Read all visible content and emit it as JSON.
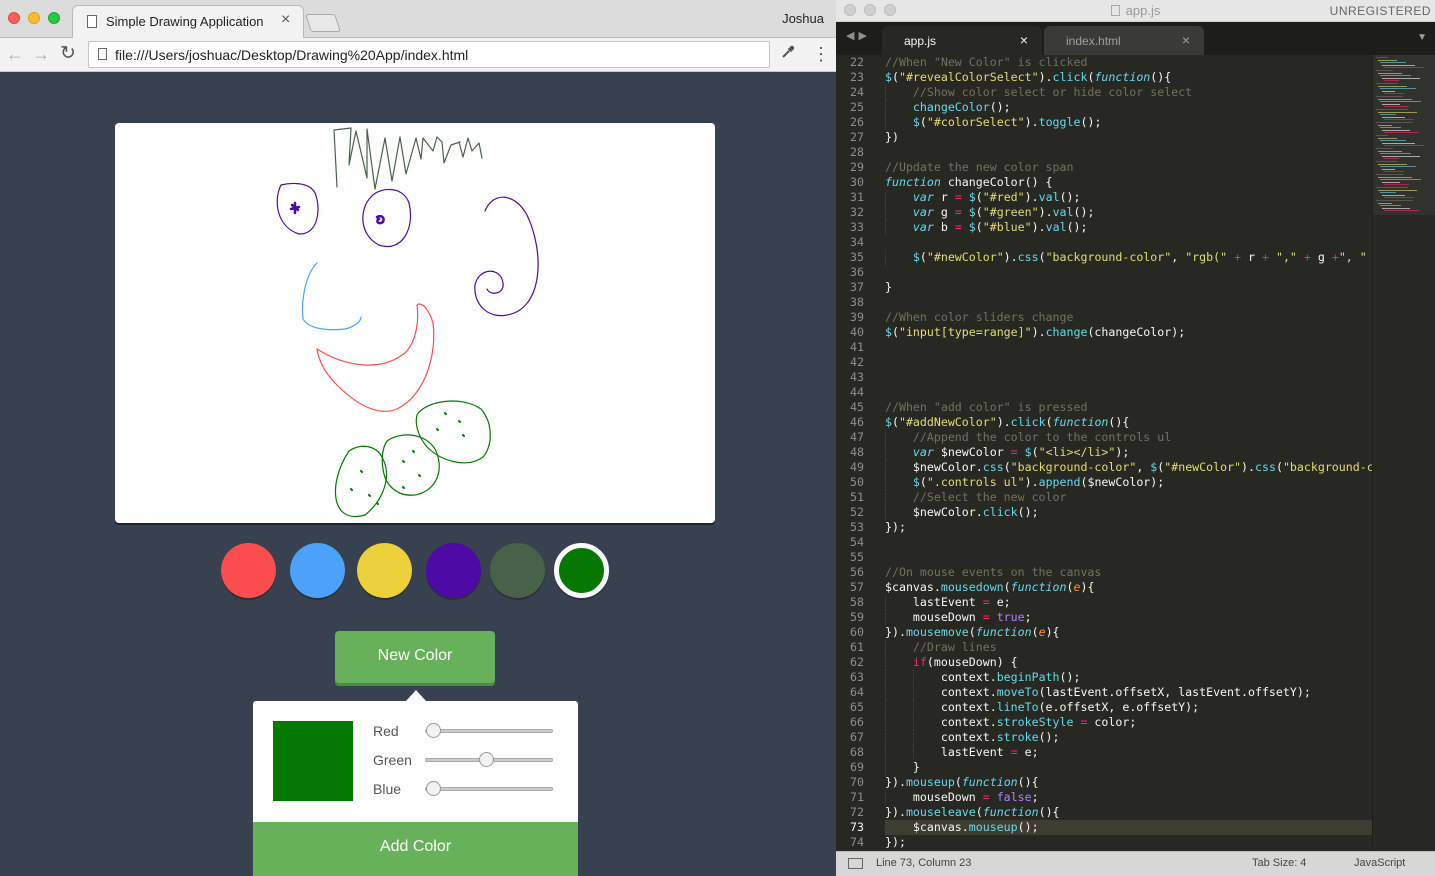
{
  "browser": {
    "tab_title": "Simple Drawing Application",
    "tab_close": "×",
    "profile_name": "Joshua",
    "url": "file:///Users/joshuac/Desktop/Drawing%20App/index.html",
    "back_glyph": "←",
    "forward_glyph": "→",
    "reload_glyph": "↻",
    "menu_glyph": "⋮",
    "icons": [
      "page-icon",
      "back-arrow-icon",
      "forward-arrow-icon",
      "reload-icon",
      "eyedropper-icon",
      "menu-dots-icon"
    ]
  },
  "app": {
    "swatches": [
      {
        "color": "#fc4e4e"
      },
      {
        "color": "#4ca1fa"
      },
      {
        "color": "#ecd13a"
      },
      {
        "color": "#4d0aa5"
      },
      {
        "color": "#48624a"
      },
      {
        "color": "#047803",
        "selected": true
      }
    ],
    "new_color_button": "New Color",
    "add_color_button": "Add Color",
    "preview_color": "#047803",
    "sliders": [
      {
        "label": "Red",
        "value": 0
      },
      {
        "label": "Green",
        "value": 120
      },
      {
        "label": "Blue",
        "value": 0
      }
    ],
    "slider_max": 255
  },
  "editor": {
    "title": "app.js",
    "unregistered": "UNREGISTERED",
    "tabs": [
      {
        "label": "app.js",
        "active": true
      },
      {
        "label": "index.html",
        "active": false
      }
    ],
    "tab_nav_glyph": "◀▶",
    "tab_close": "×",
    "dropdown_glyph": "▼",
    "first_line": 22,
    "current_line": 73,
    "lines": [
      [
        [
          0,
          "cm",
          "//When \"New Color\" is clicked"
        ]
      ],
      [
        [
          0,
          "fn",
          "$"
        ],
        [
          0,
          "pl",
          "("
        ],
        [
          0,
          "st",
          "\"#revealColorSelect\""
        ],
        [
          0,
          "pl",
          ")."
        ],
        [
          0,
          "fn",
          "click"
        ],
        [
          0,
          "pl",
          "("
        ],
        [
          0,
          "kw",
          "function"
        ],
        [
          0,
          "pl",
          "(){"
        ]
      ],
      [
        [
          1,
          "cm",
          "//Show color select or hide color select"
        ]
      ],
      [
        [
          1,
          "fn",
          "changeColor"
        ],
        [
          0,
          "pl",
          "();"
        ]
      ],
      [
        [
          1,
          "fn",
          "$"
        ],
        [
          0,
          "pl",
          "("
        ],
        [
          0,
          "st",
          "\"#colorSelect\""
        ],
        [
          0,
          "pl",
          ")."
        ],
        [
          0,
          "fn",
          "toggle"
        ],
        [
          0,
          "pl",
          "();"
        ]
      ],
      [
        [
          0,
          "pl",
          "})"
        ]
      ],
      [],
      [
        [
          0,
          "cm",
          "//Update the new color span"
        ]
      ],
      [
        [
          0,
          "kw",
          "function"
        ],
        [
          0,
          "pl",
          " "
        ],
        [
          0,
          "pl",
          "changeColor"
        ],
        [
          0,
          "pl",
          "() {"
        ]
      ],
      [
        [
          1,
          "kw",
          "var"
        ],
        [
          0,
          "pl",
          " r "
        ],
        [
          0,
          "op",
          "="
        ],
        [
          0,
          "pl",
          " "
        ],
        [
          0,
          "fn",
          "$"
        ],
        [
          0,
          "pl",
          "("
        ],
        [
          0,
          "st",
          "\"#red\""
        ],
        [
          0,
          "pl",
          ")."
        ],
        [
          0,
          "fn",
          "val"
        ],
        [
          0,
          "pl",
          "();"
        ]
      ],
      [
        [
          1,
          "kw",
          "var"
        ],
        [
          0,
          "pl",
          " g "
        ],
        [
          0,
          "op",
          "="
        ],
        [
          0,
          "pl",
          " "
        ],
        [
          0,
          "fn",
          "$"
        ],
        [
          0,
          "pl",
          "("
        ],
        [
          0,
          "st",
          "\"#green\""
        ],
        [
          0,
          "pl",
          ")."
        ],
        [
          0,
          "fn",
          "val"
        ],
        [
          0,
          "pl",
          "();"
        ]
      ],
      [
        [
          1,
          "kw",
          "var"
        ],
        [
          0,
          "pl",
          " b "
        ],
        [
          0,
          "op",
          "="
        ],
        [
          0,
          "pl",
          " "
        ],
        [
          0,
          "fn",
          "$"
        ],
        [
          0,
          "pl",
          "("
        ],
        [
          0,
          "st",
          "\"#blue\""
        ],
        [
          0,
          "pl",
          ")."
        ],
        [
          0,
          "fn",
          "val"
        ],
        [
          0,
          "pl",
          "();"
        ]
      ],
      [],
      [
        [
          1,
          "fn",
          "$"
        ],
        [
          0,
          "pl",
          "("
        ],
        [
          0,
          "st",
          "\"#newColor\""
        ],
        [
          0,
          "pl",
          ")."
        ],
        [
          0,
          "fn",
          "css"
        ],
        [
          0,
          "pl",
          "("
        ],
        [
          0,
          "st",
          "\"background-color\""
        ],
        [
          0,
          "pl",
          ", "
        ],
        [
          0,
          "st",
          "\"rgb(\""
        ],
        [
          0,
          "pl",
          " "
        ],
        [
          0,
          "op",
          "+"
        ],
        [
          0,
          "pl",
          " r "
        ],
        [
          0,
          "op",
          "+"
        ],
        [
          0,
          "pl",
          " "
        ],
        [
          0,
          "st",
          "\",\""
        ],
        [
          0,
          "pl",
          " "
        ],
        [
          0,
          "op",
          "+"
        ],
        [
          0,
          "pl",
          " g "
        ],
        [
          0,
          "op",
          "+"
        ],
        [
          0,
          "st",
          "\", \""
        ]
      ],
      [],
      [
        [
          0,
          "pl",
          "}"
        ]
      ],
      [],
      [
        [
          0,
          "cm",
          "//When color sliders change"
        ]
      ],
      [
        [
          0,
          "fn",
          "$"
        ],
        [
          0,
          "pl",
          "("
        ],
        [
          0,
          "st",
          "\"input[type=range]\""
        ],
        [
          0,
          "pl",
          ")."
        ],
        [
          0,
          "fn",
          "change"
        ],
        [
          0,
          "pl",
          "(changeColor);"
        ]
      ],
      [],
      [],
      [],
      [],
      [
        [
          0,
          "cm",
          "//When \"add color\" is pressed"
        ]
      ],
      [
        [
          0,
          "fn",
          "$"
        ],
        [
          0,
          "pl",
          "("
        ],
        [
          0,
          "st",
          "\"#addNewColor\""
        ],
        [
          0,
          "pl",
          ")."
        ],
        [
          0,
          "fn",
          "click"
        ],
        [
          0,
          "pl",
          "("
        ],
        [
          0,
          "kw",
          "function"
        ],
        [
          0,
          "pl",
          "(){"
        ]
      ],
      [
        [
          1,
          "cm",
          "//Append the color to the controls ul"
        ]
      ],
      [
        [
          1,
          "kw",
          "var"
        ],
        [
          0,
          "pl",
          " $newColor "
        ],
        [
          0,
          "op",
          "="
        ],
        [
          0,
          "pl",
          " "
        ],
        [
          0,
          "fn",
          "$"
        ],
        [
          0,
          "pl",
          "("
        ],
        [
          0,
          "st",
          "\"<li></li>\""
        ],
        [
          0,
          "pl",
          ");"
        ]
      ],
      [
        [
          1,
          "pl",
          "$newColor."
        ],
        [
          0,
          "fn",
          "css"
        ],
        [
          0,
          "pl",
          "("
        ],
        [
          0,
          "st",
          "\"background-color\""
        ],
        [
          0,
          "pl",
          ", "
        ],
        [
          0,
          "fn",
          "$"
        ],
        [
          0,
          "pl",
          "("
        ],
        [
          0,
          "st",
          "\"#newColor\""
        ],
        [
          0,
          "pl",
          ")."
        ],
        [
          0,
          "fn",
          "css"
        ],
        [
          0,
          "pl",
          "("
        ],
        [
          0,
          "st",
          "\"background-c"
        ]
      ],
      [
        [
          1,
          "fn",
          "$"
        ],
        [
          0,
          "pl",
          "("
        ],
        [
          0,
          "st",
          "\".controls ul\""
        ],
        [
          0,
          "pl",
          ")."
        ],
        [
          0,
          "fn",
          "append"
        ],
        [
          0,
          "pl",
          "($newColor);"
        ]
      ],
      [
        [
          1,
          "cm",
          "//Select the new color"
        ]
      ],
      [
        [
          1,
          "pl",
          "$newColor."
        ],
        [
          0,
          "fn",
          "click"
        ],
        [
          0,
          "pl",
          "();"
        ]
      ],
      [
        [
          0,
          "pl",
          "});"
        ]
      ],
      [],
      [],
      [
        [
          0,
          "cm",
          "//On mouse events on the canvas"
        ]
      ],
      [
        [
          0,
          "pl",
          "$canvas."
        ],
        [
          0,
          "fn",
          "mousedown"
        ],
        [
          0,
          "pl",
          "("
        ],
        [
          0,
          "kw",
          "function"
        ],
        [
          0,
          "pl",
          "("
        ],
        [
          0,
          "pm",
          "e"
        ],
        [
          0,
          "pl",
          "){"
        ]
      ],
      [
        [
          1,
          "pl",
          "lastEvent "
        ],
        [
          0,
          "op",
          "="
        ],
        [
          0,
          "pl",
          " e;"
        ]
      ],
      [
        [
          1,
          "pl",
          "mouseDown "
        ],
        [
          0,
          "op",
          "="
        ],
        [
          0,
          "pl",
          " "
        ],
        [
          0,
          "nm",
          "true"
        ],
        [
          0,
          "pl",
          ";"
        ]
      ],
      [
        [
          0,
          "pl",
          "})."
        ],
        [
          0,
          "fn",
          "mousemove"
        ],
        [
          0,
          "pl",
          "("
        ],
        [
          0,
          "kw",
          "function"
        ],
        [
          0,
          "pl",
          "("
        ],
        [
          0,
          "pm",
          "e"
        ],
        [
          0,
          "pl",
          "){"
        ]
      ],
      [
        [
          1,
          "cm",
          "//Draw lines"
        ]
      ],
      [
        [
          1,
          "op",
          "if"
        ],
        [
          0,
          "pl",
          "(mouseDown) {"
        ]
      ],
      [
        [
          2,
          "pl",
          "context."
        ],
        [
          0,
          "fn",
          "beginPath"
        ],
        [
          0,
          "pl",
          "();"
        ]
      ],
      [
        [
          2,
          "pl",
          "context."
        ],
        [
          0,
          "fn",
          "moveTo"
        ],
        [
          0,
          "pl",
          "(lastEvent.offsetX, lastEvent.offsetY);"
        ]
      ],
      [
        [
          2,
          "pl",
          "context."
        ],
        [
          0,
          "fn",
          "lineTo"
        ],
        [
          0,
          "pl",
          "(e.offsetX, e.offsetY);"
        ]
      ],
      [
        [
          2,
          "pl",
          "context."
        ],
        [
          0,
          "fn",
          "strokeStyle"
        ],
        [
          0,
          "pl",
          " "
        ],
        [
          0,
          "op",
          "="
        ],
        [
          0,
          "pl",
          " color;"
        ]
      ],
      [
        [
          2,
          "pl",
          "context."
        ],
        [
          0,
          "fn",
          "stroke"
        ],
        [
          0,
          "pl",
          "();"
        ]
      ],
      [
        [
          2,
          "pl",
          "lastEvent "
        ],
        [
          0,
          "op",
          "="
        ],
        [
          0,
          "pl",
          " e;"
        ]
      ],
      [
        [
          1,
          "pl",
          "}"
        ]
      ],
      [
        [
          0,
          "pl",
          "})."
        ],
        [
          0,
          "fn",
          "mouseup"
        ],
        [
          0,
          "pl",
          "("
        ],
        [
          0,
          "kw",
          "function"
        ],
        [
          0,
          "pl",
          "(){"
        ]
      ],
      [
        [
          1,
          "pl",
          "mouseDown "
        ],
        [
          0,
          "op",
          "="
        ],
        [
          0,
          "pl",
          " "
        ],
        [
          0,
          "nm",
          "false"
        ],
        [
          0,
          "pl",
          ";"
        ]
      ],
      [
        [
          0,
          "pl",
          "})."
        ],
        [
          0,
          "fn",
          "mouseleave"
        ],
        [
          0,
          "pl",
          "("
        ],
        [
          0,
          "kw",
          "function"
        ],
        [
          0,
          "pl",
          "(){"
        ]
      ],
      [
        [
          1,
          "pl",
          "$canvas."
        ],
        [
          0,
          "fn",
          "mouseup"
        ],
        [
          0,
          "pl",
          "();"
        ]
      ],
      [
        [
          0,
          "pl",
          "});"
        ]
      ]
    ],
    "status": {
      "position": "Line 73, Column 23",
      "tab_size": "Tab Size: 4",
      "syntax": "JavaScript"
    }
  },
  "colors": {
    "monokai_bg": "#272822",
    "comment": "#75715e",
    "string": "#e6db74",
    "keyword": "#66d9ef",
    "operator": "#f92672",
    "number": "#ae81ff",
    "param": "#fd971f",
    "app_bg": "#384150",
    "button_green": "#67b15a"
  }
}
